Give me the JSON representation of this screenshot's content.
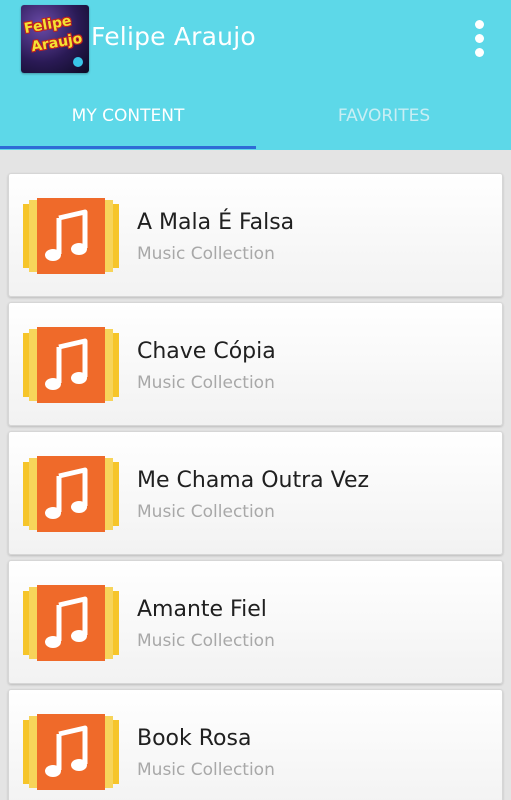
{
  "app": {
    "title": "Felipe Araujo",
    "icon_art_lines": [
      "Felipe",
      "Araujo"
    ]
  },
  "tabs": [
    {
      "label": "MY CONTENT",
      "active": true
    },
    {
      "label": "FAVORITES",
      "active": false
    }
  ],
  "items": [
    {
      "title": "A Mala É Falsa",
      "subtitle": "Music Collection"
    },
    {
      "title": "Chave Cópia",
      "subtitle": "Music Collection"
    },
    {
      "title": "Me Chama Outra Vez",
      "subtitle": "Music Collection"
    },
    {
      "title": "Amante Fiel",
      "subtitle": "Music Collection"
    },
    {
      "title": "Book Rosa",
      "subtitle": "Music Collection"
    }
  ],
  "icons": {
    "overflow": "more-vert-icon",
    "item": "music-note-icon"
  },
  "colors": {
    "appbar": "#5dd8e8",
    "tab_indicator": "#2e6bd6",
    "music_icon_orange": "#ef6a2a",
    "music_icon_yellow": "#f6c52a"
  }
}
